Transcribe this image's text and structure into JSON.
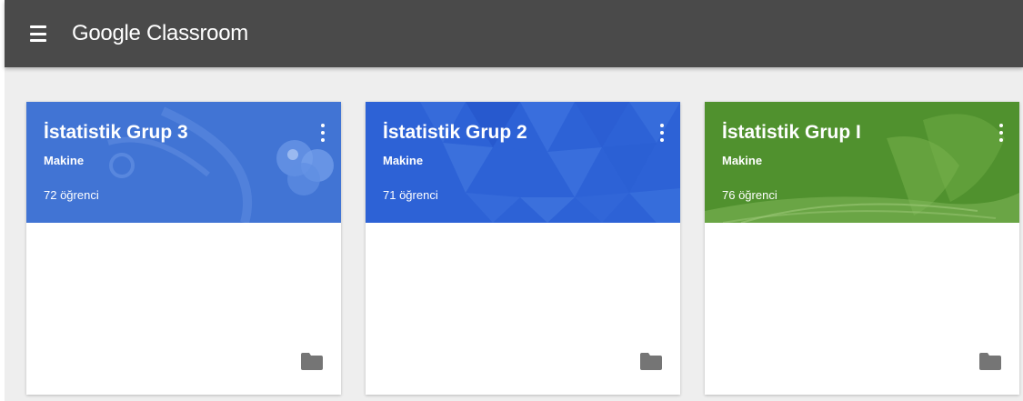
{
  "app": {
    "title": "Google Classroom"
  },
  "colors": {
    "appbar": "#4a4a4a",
    "background": "#eeeeee",
    "card_blue_1": "#3d6fd1",
    "card_blue_2": "#2d62d6",
    "card_green": "#4a8a2a"
  },
  "icons": {
    "menu": "menu-icon",
    "more": "more-vert-icon",
    "folder": "folder-icon"
  },
  "classes": [
    {
      "title": "İstatistik Grup 3",
      "section": "Makine",
      "students": "72 öğrenci",
      "theme": "blue-medical"
    },
    {
      "title": "İstatistik Grup 2",
      "section": "Makine",
      "students": "71 öğrenci",
      "theme": "blue-geometric"
    },
    {
      "title": "İstatistik Grup I",
      "section": "Makine",
      "students": "76 öğrenci",
      "theme": "green-book"
    }
  ]
}
